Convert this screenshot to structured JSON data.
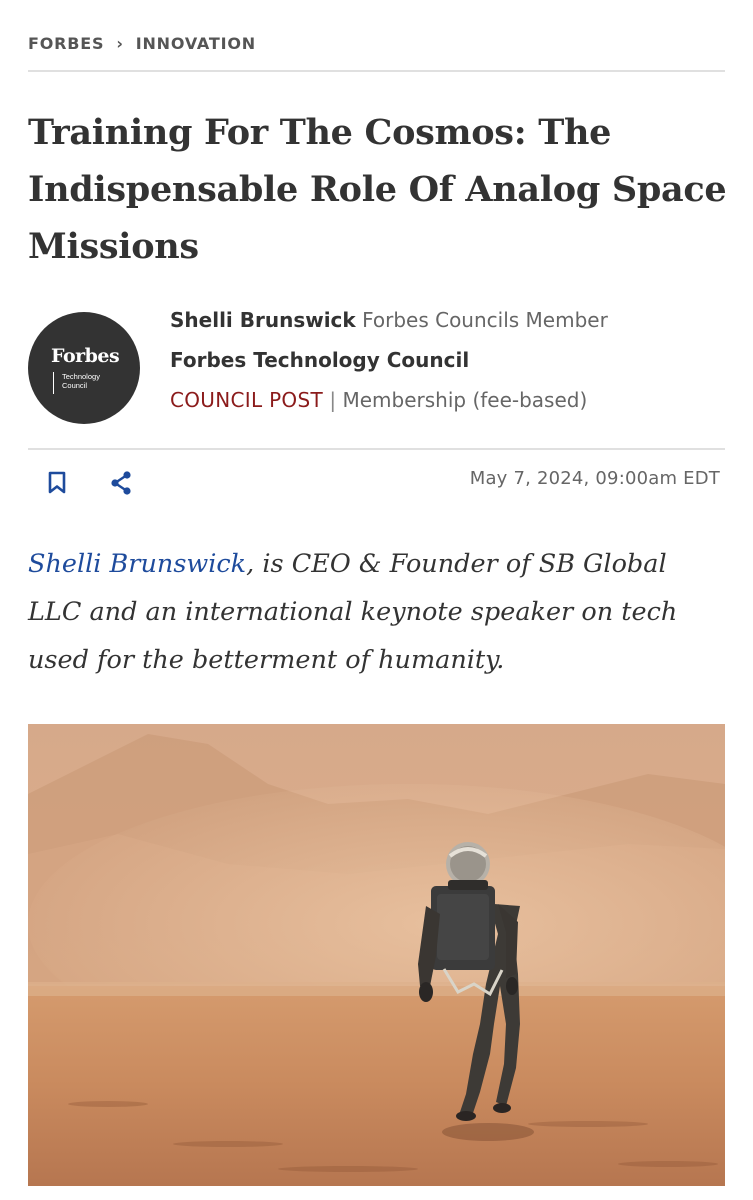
{
  "breadcrumb": {
    "items": [
      "FORBES",
      "INNOVATION"
    ],
    "separator": "›"
  },
  "article": {
    "title": "Training For The Cosmos: The Indispensable Role Of Analog Space Missions",
    "date": "May 7, 2024, 09:00am EDT"
  },
  "logo": {
    "word": "Forbes",
    "line1": "Technology",
    "line2": "Council"
  },
  "byline": {
    "author": "Shelli Brunswick",
    "member_label": "Forbes Councils Member",
    "council": "Forbes Technology Council",
    "post_label": "COUNCIL POST",
    "pipe": "|",
    "membership": "Membership (fee-based)"
  },
  "intro": {
    "author_link": "Shelli Brunswick",
    "text": ", is CEO & Founder of SB Global LLC and an international keynote speaker on tech used for the betterment of humanity."
  },
  "icons": {
    "bookmark": "bookmark-icon",
    "share": "share-icon"
  },
  "colors": {
    "post_red": "#8b1b1b",
    "link_blue": "#1e4b9c",
    "logo_bg": "#333333",
    "sand": "#c98a5e"
  }
}
